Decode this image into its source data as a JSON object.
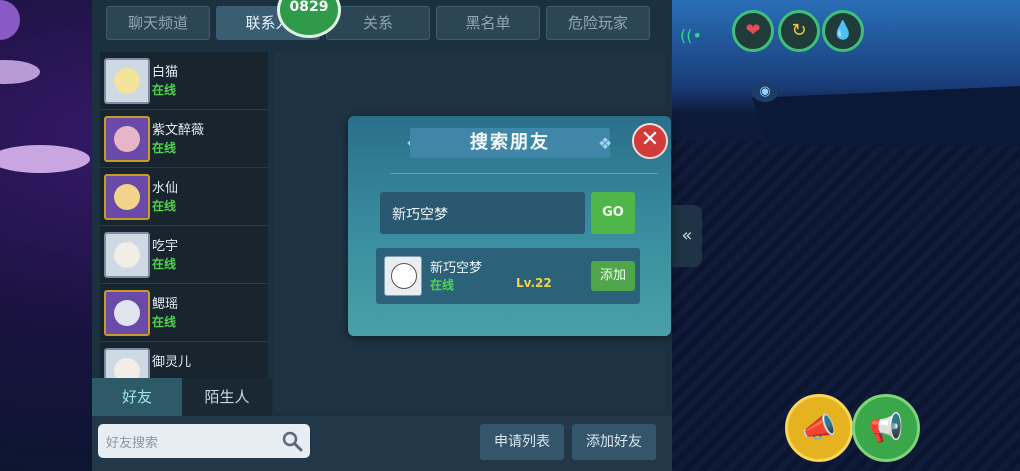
{
  "top_tabs": [
    "聊天频道",
    "联系人",
    "关系",
    "黑名单",
    "危险玩家"
  ],
  "online_badge": "0829",
  "contacts": [
    {
      "name": "白猫",
      "status": "在线"
    },
    {
      "name": "紫文醉薇",
      "status": "在线"
    },
    {
      "name": "水仙",
      "status": "在线"
    },
    {
      "name": "吃宇",
      "status": "在线"
    },
    {
      "name": "鳃瑶",
      "status": "在线"
    },
    {
      "name": "御灵儿",
      "status": ""
    }
  ],
  "sub_tabs": {
    "friends": "好友",
    "strangers": "陌生人"
  },
  "bottom": {
    "search_placeholder": "好友搜索",
    "request_list": "申请列表",
    "add_friend": "添加好友"
  },
  "dialog": {
    "title": "搜索朋友",
    "input_value": "新巧空梦",
    "go_label": "GO",
    "result": {
      "name": "新巧空梦",
      "status": "在线",
      "level": "Lv.22",
      "add_label": "添加"
    }
  },
  "colors": {
    "online": "#4fd34f",
    "level": "#f2d24a",
    "accent": "#4fb64a",
    "close": "#d33a3a"
  }
}
